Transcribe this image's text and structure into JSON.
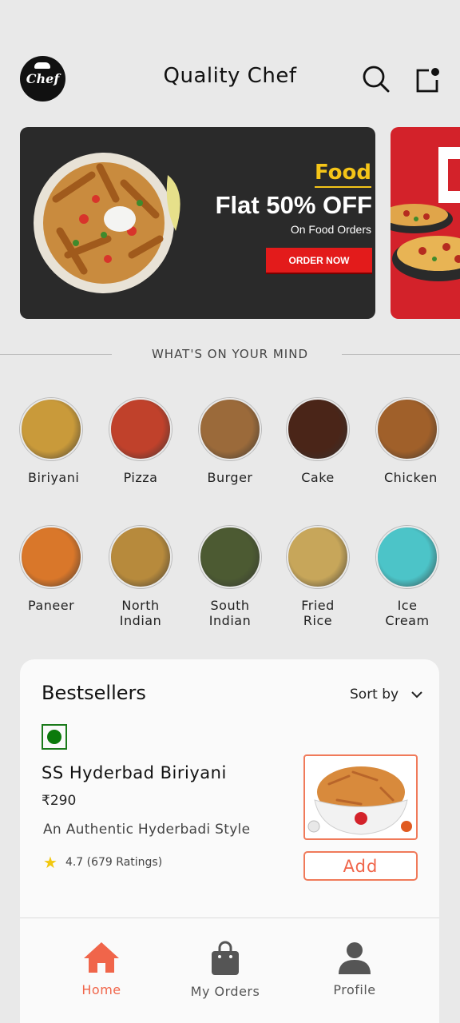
{
  "header": {
    "logo_text": "Chef",
    "title": "Quality Chef",
    "search_icon": "search-icon",
    "notification_icon": "notification-icon"
  },
  "banner": {
    "food_word": "Food",
    "headline": "Flat 50% OFF",
    "subline": "On Food Orders",
    "cta": "ORDER NOW"
  },
  "categories_section": {
    "title": "WHAT'S ON YOUR MIND",
    "items": [
      {
        "label": "Biriyani",
        "color": "#c99a3a"
      },
      {
        "label": "Pizza",
        "color": "#c0412b"
      },
      {
        "label": "Burger",
        "color": "#9b6a3a"
      },
      {
        "label": "Cake",
        "color": "#4a2518"
      },
      {
        "label": "Chicken",
        "color": "#a0602a"
      },
      {
        "label": "Paneer",
        "color": "#d9772a"
      },
      {
        "label": "North Indian",
        "color": "#b78a3c"
      },
      {
        "label": "South Indian",
        "color": "#4c5a32"
      },
      {
        "label": "Fried Rice",
        "color": "#c7a65a"
      },
      {
        "label": "Ice Cream",
        "color": "#4cc4c8"
      }
    ]
  },
  "bestsellers": {
    "title": "Bestsellers",
    "sort_label": "Sort by",
    "item": {
      "name": "SS Hyderbad Biriyani",
      "price": "₹290",
      "description": "An Authentic Hyderbadi Style",
      "rating": "4.7 (679 Ratings)",
      "add_label": "Add",
      "veg": true
    }
  },
  "bottom_nav": {
    "items": [
      {
        "label": "Home",
        "icon": "home-icon",
        "active": true
      },
      {
        "label": "My Orders",
        "icon": "shopping-bag-icon",
        "active": false
      },
      {
        "label": "Profile",
        "icon": "profile-icon",
        "active": false
      }
    ]
  },
  "colors": {
    "accent": "#f0654a",
    "banner_bg": "#2a2a2a",
    "cta_red": "#e31b1b",
    "veg_green": "#0b7a0b"
  }
}
